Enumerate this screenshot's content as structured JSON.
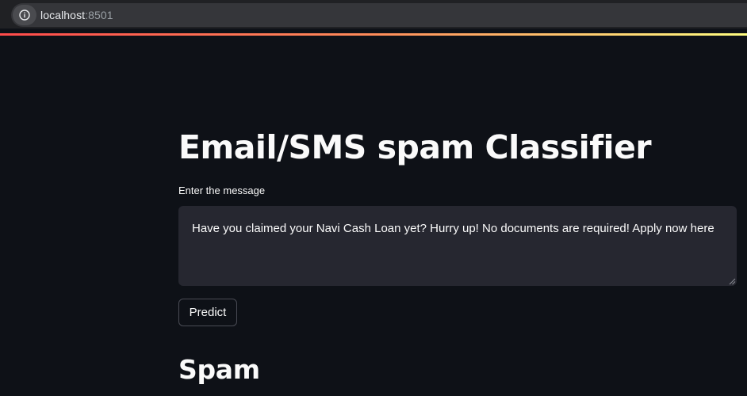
{
  "browser": {
    "url_host": "localhost",
    "url_port": ":8501"
  },
  "app": {
    "title": "Email/SMS spam Classifier",
    "input_label": "Enter the message",
    "input_value": "Have you claimed your Navi Cash Loan yet? Hurry up! No documents are required! Apply now here",
    "predict_label": "Predict",
    "result": "Spam"
  },
  "colors": {
    "background": "#0e1117",
    "text": "#fafafa",
    "input_bg": "#262730",
    "decoration_start": "#ff4b4b",
    "decoration_end": "#fffd80"
  }
}
